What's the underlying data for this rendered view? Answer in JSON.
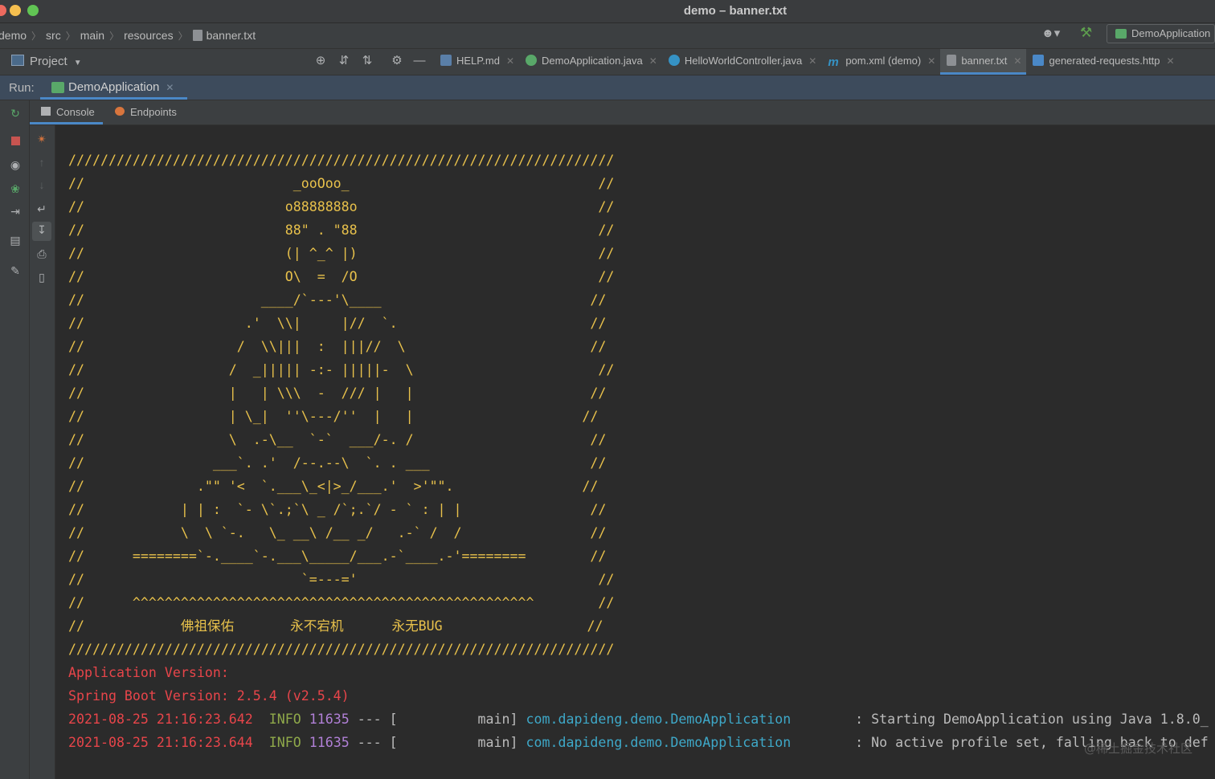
{
  "window": {
    "title": "demo – banner.txt"
  },
  "navbar": {
    "breadcrumbs": [
      "demo",
      "src",
      "main",
      "resources",
      "banner.txt"
    ],
    "run_config": "DemoApplication"
  },
  "toolbar": {
    "project_selector": "Project",
    "tabs": [
      {
        "label": "HELP.md",
        "icon": "markdown-file-icon",
        "active": false
      },
      {
        "label": "DemoApplication.java",
        "icon": "spring-class-icon",
        "active": false
      },
      {
        "label": "HelloWorldController.java",
        "icon": "java-class-icon",
        "active": false
      },
      {
        "label": "pom.xml (demo)",
        "icon": "maven-icon",
        "active": false
      },
      {
        "label": "banner.txt",
        "icon": "text-file-icon",
        "active": true
      },
      {
        "label": "generated-requests.http",
        "icon": "http-file-icon",
        "active": false
      }
    ]
  },
  "run": {
    "label": "Run:",
    "tab": "DemoApplication",
    "console_tab": "Console",
    "endpoints_tab": "Endpoints"
  },
  "console": {
    "banner": [
      "////////////////////////////////////////////////////////////////////",
      "//                          _ooOoo_                               //",
      "//                         o8888888o                              //",
      "//                         88\" . \"88                              //",
      "//                         (| ^_^ |)                              //",
      "//                         O\\  =  /O                              //",
      "//                      ____/`---'\\____                          //",
      "//                    .'  \\\\|     |//  `.                        //",
      "//                   /  \\\\|||  :  |||//  \\                       //",
      "//                  /  _||||| -:- |||||-  \\                       //",
      "//                  |   | \\\\\\  -  /// |   |                      //",
      "//                  | \\_|  ''\\---/''  |   |                     //",
      "//                  \\  .-\\__  `-`  ___/-. /                      //",
      "//                ___`. .'  /--.--\\  `. . ___                    //",
      "//              .\"\" '<  `.___\\_<|>_/___.'  >'\"\".                //",
      "//            | | :  `- \\`.;`\\ _ /`;.`/ - ` : | |                //",
      "//            \\  \\ `-.   \\_ __\\ /__ _/   .-` /  /                //",
      "//      ========`-.____`-.___\\_____/___.-`____.-'========        //",
      "//                           `=---='                              //",
      "//      ^^^^^^^^^^^^^^^^^^^^^^^^^^^^^^^^^^^^^^^^^^^^^^^^^^        //",
      "//            佛祖保佑       永不宕机      永无BUG                  //",
      "////////////////////////////////////////////////////////////////////"
    ],
    "blank": "",
    "app_version": "Application Version:",
    "boot_version": "Spring Boot Version: 2.5.4 (v2.5.4)",
    "logs": [
      {
        "time": "2021-08-25 21:16:23.642",
        "level": "INFO",
        "pid": "11635",
        "sep": "--- [",
        "thread": "main]",
        "logger": "com.dapideng.demo.DemoApplication",
        "msg": ": Starting DemoApplication using Java 1.8.0_"
      },
      {
        "time": "2021-08-25 21:16:23.644",
        "level": "INFO",
        "pid": "11635",
        "sep": "--- [",
        "thread": "main]",
        "logger": "com.dapideng.demo.DemoApplication",
        "msg": ": No active profile set, falling back to def"
      }
    ],
    "watermark": "@稀土掘金技术社区"
  },
  "colors": {
    "banner": "#e8c14b",
    "error": "#e8454a",
    "accent": "#4a88c7"
  }
}
